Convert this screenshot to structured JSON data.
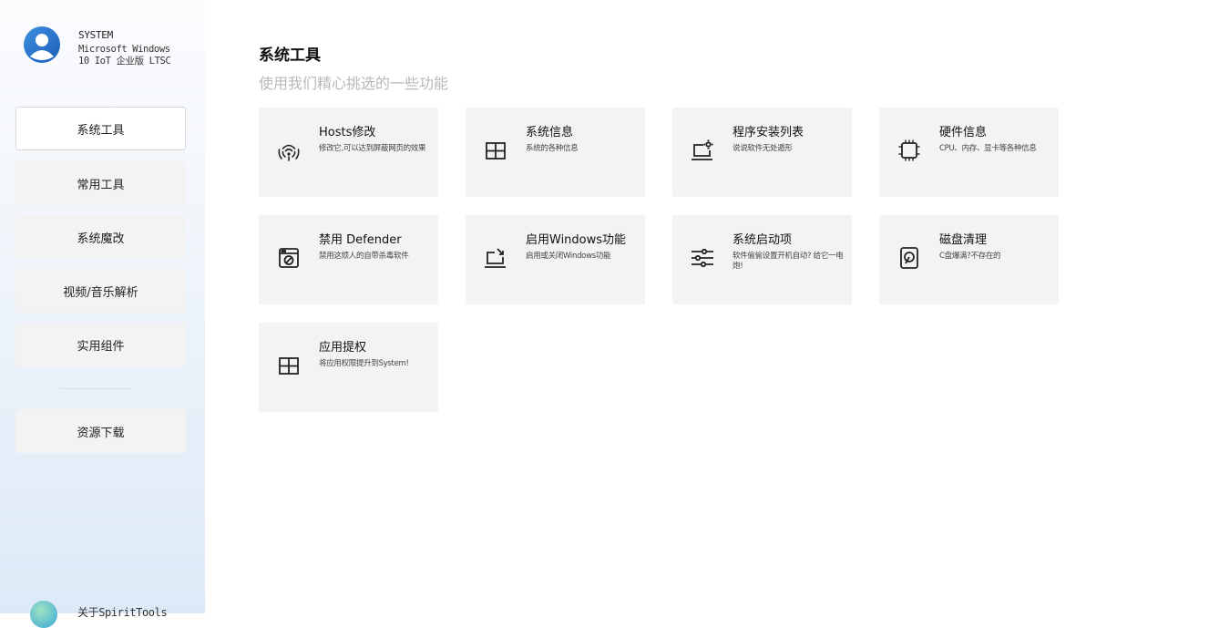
{
  "user": {
    "name": "SYSTEM",
    "os": "Microsoft Windows\n10 IoT 企业版 LTSC",
    "avatar_icon": "user-avatar-icon"
  },
  "nav": {
    "items": [
      {
        "label": "系统工具",
        "active": true
      },
      {
        "label": "常用工具"
      },
      {
        "label": "系统魔改"
      },
      {
        "label": "视频/音乐解析"
      },
      {
        "label": "实用组件"
      },
      {
        "label": "资源下载"
      }
    ],
    "about_label": "关于SpiritTools"
  },
  "page": {
    "title": "系统工具",
    "subtitle": "使用我们精心挑选的一些功能"
  },
  "cards": [
    {
      "title": "Hosts修改",
      "desc": "修改它,可以达到屏蔽网页的效果",
      "icon": "wifi-broadcast-icon"
    },
    {
      "title": "系统信息",
      "desc": "系统的各种信息",
      "icon": "windows-logo-icon"
    },
    {
      "title": "程序安装列表",
      "desc": "说说软件无处遁形",
      "icon": "laptop-gear-icon"
    },
    {
      "title": "硬件信息",
      "desc": "CPU、内存、显卡等各种信息",
      "icon": "chip-icon"
    },
    {
      "title": "禁用 Defender",
      "desc": "禁用这烦人的自带杀毒软件",
      "icon": "blocked-window-icon"
    },
    {
      "title": "启用Windows功能",
      "desc": "启用或关闭Windows功能",
      "icon": "laptop-arrow-icon"
    },
    {
      "title": "系统启动项",
      "desc": "软件偷偷设置开机自动? 给它一电炮!",
      "icon": "sliders-icon"
    },
    {
      "title": "磁盘清理",
      "desc": "C盘爆满?不存在的",
      "icon": "disk-icon"
    },
    {
      "title": "应用提权",
      "desc": "将应用权限提升到System!",
      "icon": "windows-logo-icon"
    }
  ]
}
